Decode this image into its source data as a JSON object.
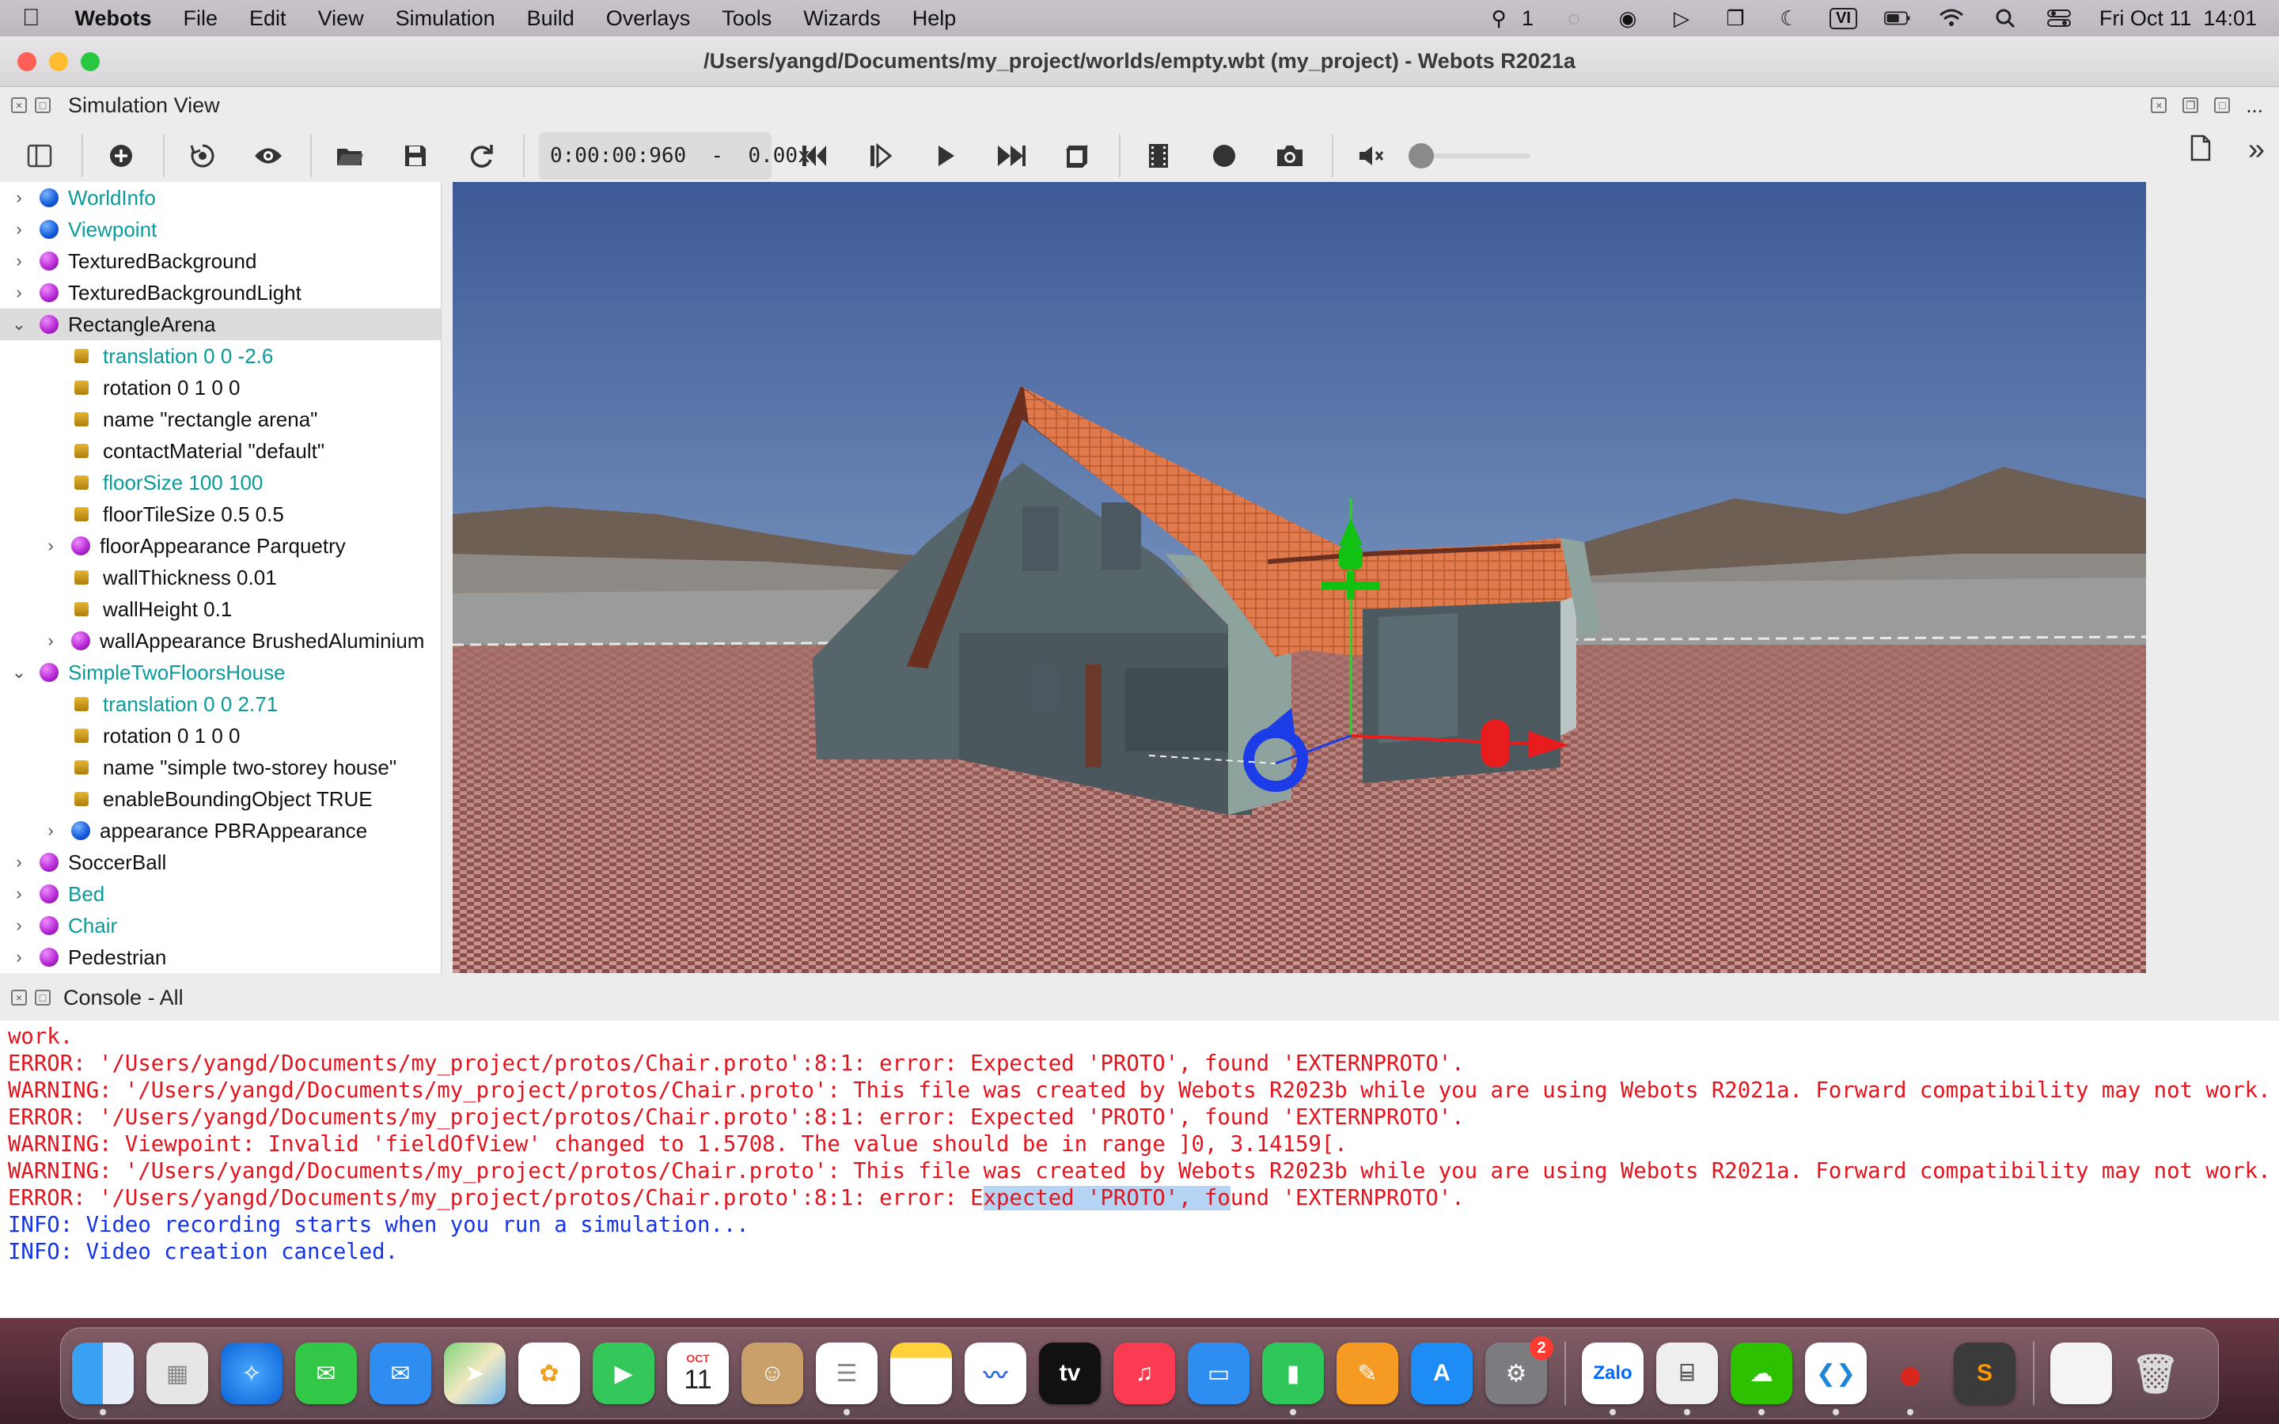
{
  "menubar": {
    "app_name": "Webots",
    "menus": [
      "File",
      "Edit",
      "View",
      "Simulation",
      "Build",
      "Overlays",
      "Tools",
      "Wizards",
      "Help"
    ],
    "wechat_count": "1",
    "input_source": "VI",
    "datetime": "Fri Oct 11  14:01"
  },
  "window": {
    "title": "/Users/yangd/Documents/my_project/worlds/empty.wbt (my_project) - Webots R2021a"
  },
  "simulation_view": {
    "title": "Simulation View",
    "time": "0:00:00:960  -  0.00x",
    "overflow": "...",
    "more": "»"
  },
  "scene_tree": [
    {
      "label": "WorldInfo",
      "node": "blue",
      "teal": true,
      "depth": 0,
      "arrow": "›"
    },
    {
      "label": "Viewpoint",
      "node": "blue",
      "teal": true,
      "depth": 0,
      "arrow": "›"
    },
    {
      "label": "TexturedBackground",
      "node": "purple",
      "teal": false,
      "depth": 0,
      "arrow": "›"
    },
    {
      "label": "TexturedBackgroundLight",
      "node": "purple",
      "teal": false,
      "depth": 0,
      "arrow": "›"
    },
    {
      "label": "RectangleArena",
      "node": "purple",
      "teal": false,
      "depth": 0,
      "arrow": "⌄",
      "selected": true
    },
    {
      "label": "translation 0 0 -2.6",
      "node": "field",
      "teal": true,
      "depth": 1
    },
    {
      "label": "rotation 0 1 0 0",
      "node": "field",
      "teal": false,
      "depth": 1
    },
    {
      "label": "name \"rectangle arena\"",
      "node": "field",
      "teal": false,
      "depth": 1
    },
    {
      "label": "contactMaterial \"default\"",
      "node": "field",
      "teal": false,
      "depth": 1
    },
    {
      "label": "floorSize 100 100",
      "node": "field",
      "teal": true,
      "depth": 1
    },
    {
      "label": "floorTileSize 0.5 0.5",
      "node": "field",
      "teal": false,
      "depth": 1
    },
    {
      "label": "floorAppearance Parquetry",
      "node": "purple",
      "teal": false,
      "depth": 2,
      "arrow": "›"
    },
    {
      "label": "wallThickness 0.01",
      "node": "field",
      "teal": false,
      "depth": 1
    },
    {
      "label": "wallHeight 0.1",
      "node": "field",
      "teal": false,
      "depth": 1
    },
    {
      "label": "wallAppearance BrushedAluminium",
      "node": "purple",
      "teal": false,
      "depth": 2,
      "arrow": "›"
    },
    {
      "label": "SimpleTwoFloorsHouse",
      "node": "purple",
      "teal": true,
      "depth": 0,
      "arrow": "⌄"
    },
    {
      "label": "translation 0 0 2.71",
      "node": "field",
      "teal": true,
      "depth": 1
    },
    {
      "label": "rotation 0 1 0 0",
      "node": "field",
      "teal": false,
      "depth": 1
    },
    {
      "label": "name \"simple two-storey house\"",
      "node": "field",
      "teal": false,
      "depth": 1
    },
    {
      "label": "enableBoundingObject TRUE",
      "node": "field",
      "teal": false,
      "depth": 1
    },
    {
      "label": "appearance PBRAppearance",
      "node": "blue",
      "teal": false,
      "depth": 2,
      "arrow": "›"
    },
    {
      "label": "SoccerBall",
      "node": "purple",
      "teal": false,
      "depth": 0,
      "arrow": "›"
    },
    {
      "label": "Bed",
      "node": "purple",
      "teal": true,
      "depth": 0,
      "arrow": "›"
    },
    {
      "label": "Chair",
      "node": "purple",
      "teal": true,
      "depth": 0,
      "arrow": "›"
    },
    {
      "label": "Pedestrian",
      "node": "purple",
      "teal": false,
      "depth": 0,
      "arrow": "›"
    }
  ],
  "console": {
    "title": "Console - All",
    "lines": [
      {
        "level": "error",
        "text": "work."
      },
      {
        "level": "error",
        "text": "ERROR: '/Users/yangd/Documents/my_project/protos/Chair.proto':8:1: error: Expected 'PROTO', found 'EXTERNPROTO'."
      },
      {
        "level": "warning",
        "text": "WARNING: '/Users/yangd/Documents/my_project/protos/Chair.proto': This file was created by Webots R2023b while you are using Webots R2021a. Forward compatibility may not work."
      },
      {
        "level": "error",
        "text": "ERROR: '/Users/yangd/Documents/my_project/protos/Chair.proto':8:1: error: Expected 'PROTO', found 'EXTERNPROTO'."
      },
      {
        "level": "warning",
        "text": "WARNING: Viewpoint: Invalid 'fieldOfView' changed to 1.5708. The value should be in range ]0, 3.14159[."
      },
      {
        "level": "warning",
        "text": "WARNING: '/Users/yangd/Documents/my_project/protos/Chair.proto': This file was created by Webots R2023b while you are using Webots R2021a. Forward compatibility may not work."
      },
      {
        "level": "error",
        "text_before": "ERROR: '/Users/yangd/Documents/my_project/protos/Chair.proto':8:1: error: E",
        "text_highlight": "xpected 'PROTO', fo",
        "text_after": "und 'EXTERNPROTO'."
      },
      {
        "level": "info",
        "text": "INFO: Video recording starts when you run a simulation..."
      },
      {
        "level": "info",
        "text": "INFO: Video creation canceled."
      }
    ]
  },
  "dock": {
    "calendar_month": "OCT",
    "calendar_day": "11",
    "settings_badge": "2",
    "zalo_label": "Zalo",
    "tv_label": "tv"
  }
}
